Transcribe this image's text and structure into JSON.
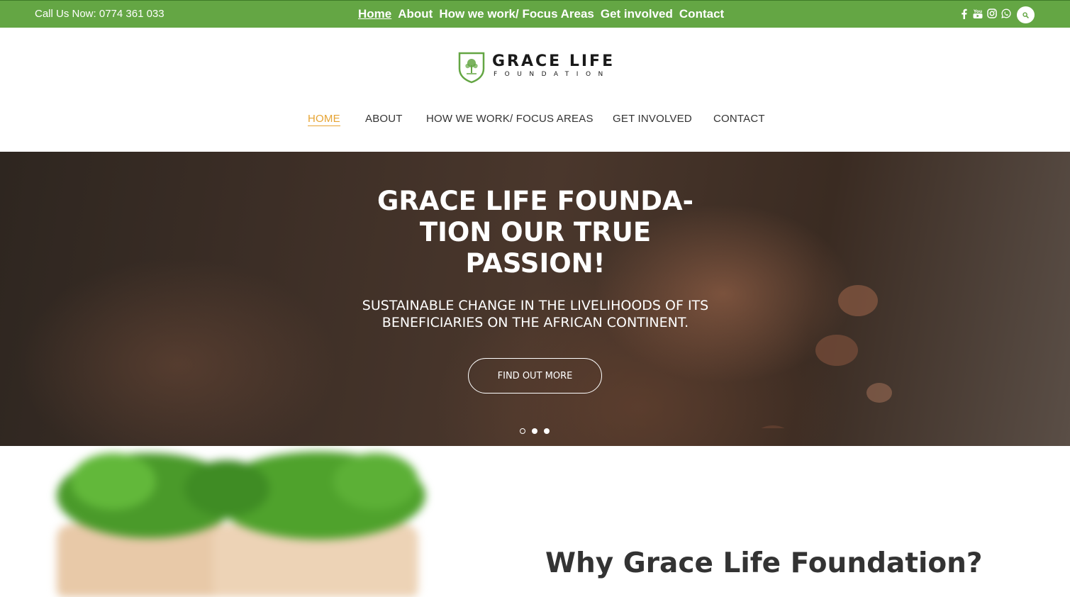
{
  "topbar": {
    "call_text": "Call Us Now: 0774 361 033",
    "nav": [
      "Home",
      "About",
      "How we work/ Focus Areas",
      "Get involved",
      "Contact"
    ],
    "social_icons": [
      "facebook-icon",
      "youtube-icon",
      "instagram-icon",
      "whatsapp-icon"
    ],
    "search_icon": "search-icon",
    "bg_color": "#64a644"
  },
  "logo": {
    "name": "GRACE LIFE",
    "sub": "FOUNDATION",
    "accent": "#64a644"
  },
  "mainnav": {
    "items": [
      "HOME",
      "ABOUT",
      "HOW WE WORK/ FOCUS AREAS",
      "GET INVOLVED",
      "CONTACT"
    ],
    "active_color": "#e6a433"
  },
  "hero": {
    "title": "GRACE LIFE FOUNDA- TION OUR TRUE PASSION!",
    "subtitle": "SUSTAINABLE CHANGE IN THE LIVELIHOODS OF ITS BENEFICIARIES ON THE AFRICAN CONTINENT.",
    "cta": "FIND OUT MORE",
    "slide_count": 3,
    "active_slide": 1
  },
  "section": {
    "heading": "Why Grace Life Foundation?"
  }
}
